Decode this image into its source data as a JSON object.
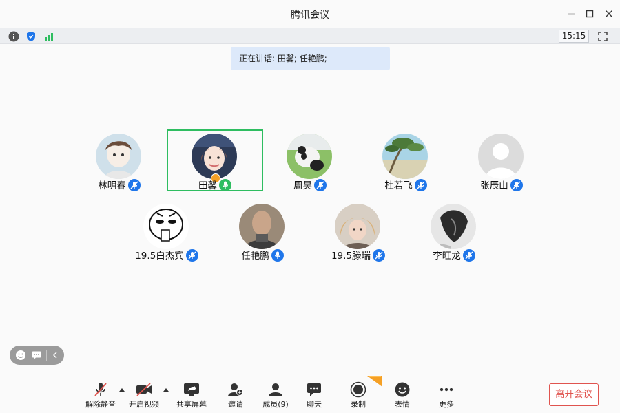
{
  "window": {
    "title": "腾讯会议",
    "controls": [
      "minimize-icon",
      "maximize-icon",
      "close-icon"
    ]
  },
  "infobar": {
    "icons": [
      "info-icon",
      "shield-icon",
      "signal-icon"
    ],
    "time": "15:15",
    "fullscreen_icon": "fullscreen-icon"
  },
  "speaking": {
    "text": "正在讲话: 田馨; 任艳鹏;"
  },
  "participants": [
    {
      "name": "林明春",
      "mic": "blue",
      "active": false
    },
    {
      "name": "田馨",
      "mic": "green",
      "active": true,
      "host": true
    },
    {
      "name": "周昊",
      "mic": "blue",
      "active": false
    },
    {
      "name": "杜若飞",
      "mic": "blue",
      "active": false
    },
    {
      "name": "张辰山",
      "mic": "blue",
      "active": false
    },
    {
      "name": "19.5白杰宾",
      "mic": "blue",
      "active": false
    },
    {
      "name": "任艳鹏",
      "mic": "blue",
      "active": false
    },
    {
      "name": "19.5滕瑞",
      "mic": "blue",
      "active": false
    },
    {
      "name": "李旺龙",
      "mic": "blue",
      "active": false
    }
  ],
  "reaction_bar": {
    "icons": [
      "emoji-icon",
      "chat-bubble-icon",
      "collapse-arrow-icon"
    ]
  },
  "toolbar": {
    "unmute": "解除静音",
    "start_video": "开启视频",
    "share_screen": "共享屏幕",
    "invite": "邀请",
    "members": "成员(9)",
    "chat": "聊天",
    "record": "录制",
    "reactions": "表情",
    "more": "更多"
  },
  "leave_button": "离开会议",
  "colors": {
    "accent_blue": "#1f76ea",
    "speaking_green": "#2ebd60",
    "leave_red": "#e0544f",
    "banner_bg": "#dde9fa"
  }
}
